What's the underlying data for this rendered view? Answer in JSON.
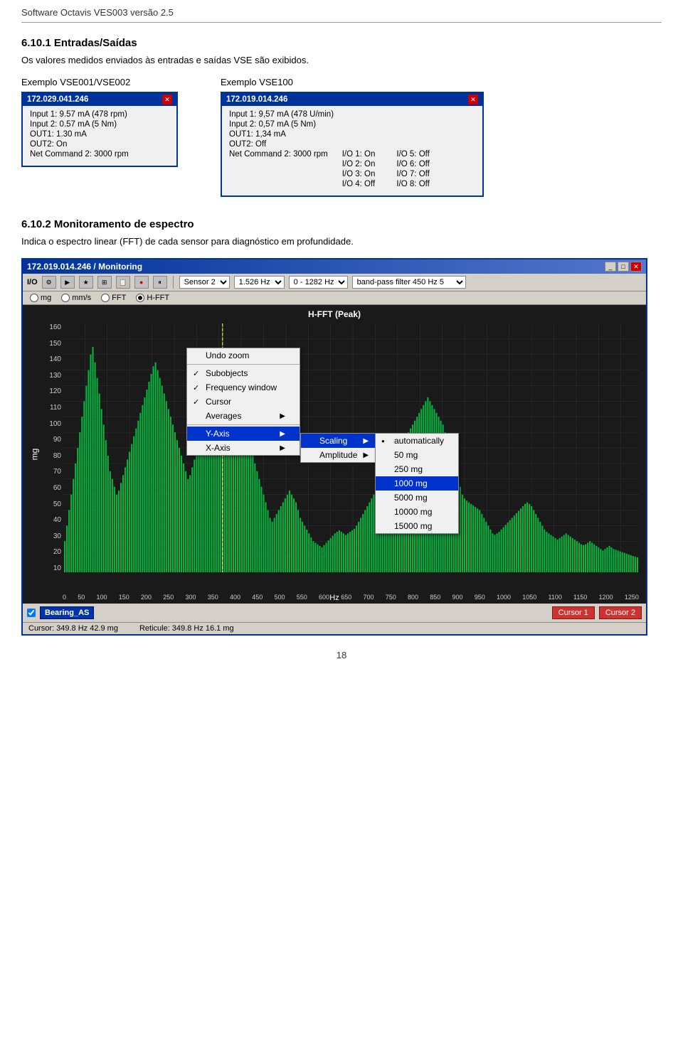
{
  "header": {
    "title": "Software Octavis VES003 versão 2.5"
  },
  "section1": {
    "heading": "6.10.1 Entradas/Saídas",
    "description": "Os valores medidos enviados às entradas e saídas VSE são exibidos.",
    "example1_label": "Exemplo VSE001/VSE002",
    "example2_label": "Exemplo VSE100",
    "dialog1": {
      "title": "172.029.041.246",
      "lines": [
        "Input 1: 9.57 mA (478 rpm)",
        "Input 2: 0.57 mA (5 Nm)",
        "OUT1: 1.30 mA",
        "OUT2: On",
        "Net Command 2: 3000 rpm"
      ]
    },
    "dialog2": {
      "title": "172.019.014.246",
      "lines": [
        "Input 1: 9,57 mA (478 U/min)",
        "Input 2: 0,57 mA (5 Nm)",
        "OUT1: 1,34 mA",
        "OUT2: Off",
        "Net Command 2: 3000 rpm"
      ],
      "io_left": [
        "I/O 1: On",
        "I/O 2: On",
        "I/O 3: On",
        "I/O 4: Off"
      ],
      "io_right": [
        "I/O 5: Off",
        "I/O 6: Off",
        "I/O 7: Off",
        "I/O 8: Off"
      ]
    }
  },
  "section2": {
    "heading": "6.10.2 Monitoramento de espectro",
    "description": "Indica o espectro linear (FFT) de cada sensor para diagnóstico em profundidade."
  },
  "monitoring": {
    "title": "172.019.014.246 / Monitoring",
    "toolbar": {
      "io_label": "I/O",
      "sensor_select": "Sensor 2",
      "freq1_select": "1.526 Hz",
      "freq2_select": "0 - 1282 Hz",
      "filter_select": "band-pass filter 450 Hz 5"
    },
    "radio_options": [
      "mg",
      "mm/s",
      "FFT",
      "H-FFT"
    ],
    "selected_radio": "H-FFT",
    "chart": {
      "title": "H-FFT (Peak)",
      "y_unit": "mg",
      "x_unit": "Hz",
      "y_labels": [
        "160",
        "150",
        "140",
        "130",
        "120",
        "110",
        "100",
        "90",
        "80",
        "70",
        "60",
        "50",
        "40",
        "30",
        "20",
        "10"
      ],
      "x_labels": [
        "0",
        "50",
        "100",
        "150",
        "200",
        "250",
        "300",
        "350",
        "400",
        "450",
        "500",
        "550",
        "600",
        "650",
        "700",
        "750",
        "800",
        "850",
        "900",
        "950",
        "1000",
        "1050",
        "1100",
        "1150",
        "1200",
        "1250"
      ]
    },
    "context_menu": {
      "items": [
        {
          "label": "Undo zoom",
          "checked": false,
          "has_arrow": false
        },
        {
          "label": "Subobjects",
          "checked": true,
          "has_arrow": false
        },
        {
          "label": "Frequency window",
          "checked": true,
          "has_arrow": false
        },
        {
          "label": "Cursor",
          "checked": true,
          "has_arrow": false
        },
        {
          "label": "Averages",
          "checked": false,
          "has_arrow": true
        },
        {
          "label": "Y-Axis",
          "checked": false,
          "has_arrow": true,
          "highlighted": true
        },
        {
          "label": "X-Axis",
          "checked": false,
          "has_arrow": true
        }
      ],
      "submenu_yaxis": {
        "items": [
          {
            "label": "Scaling",
            "has_arrow": true,
            "highlighted": true
          },
          {
            "label": "Amplitude",
            "has_arrow": true
          }
        ]
      },
      "submenu_scaling": {
        "items": [
          {
            "label": "automatically",
            "bullet": true
          },
          {
            "label": "50 mg"
          },
          {
            "label": "250 mg"
          },
          {
            "label": "1000 mg",
            "selected": true
          },
          {
            "label": "5000 mg"
          },
          {
            "label": "10000 mg"
          },
          {
            "label": "15000 mg"
          }
        ]
      }
    },
    "channel": "Bearing_AS",
    "cursor1": "Cursor 1",
    "cursor2": "Cursor 2",
    "status_cursor": "Cursor: 349.8 Hz  42.9 mg",
    "status_reticule": "Reticule: 349.8 Hz  16.1 mg"
  },
  "page_number": "18"
}
